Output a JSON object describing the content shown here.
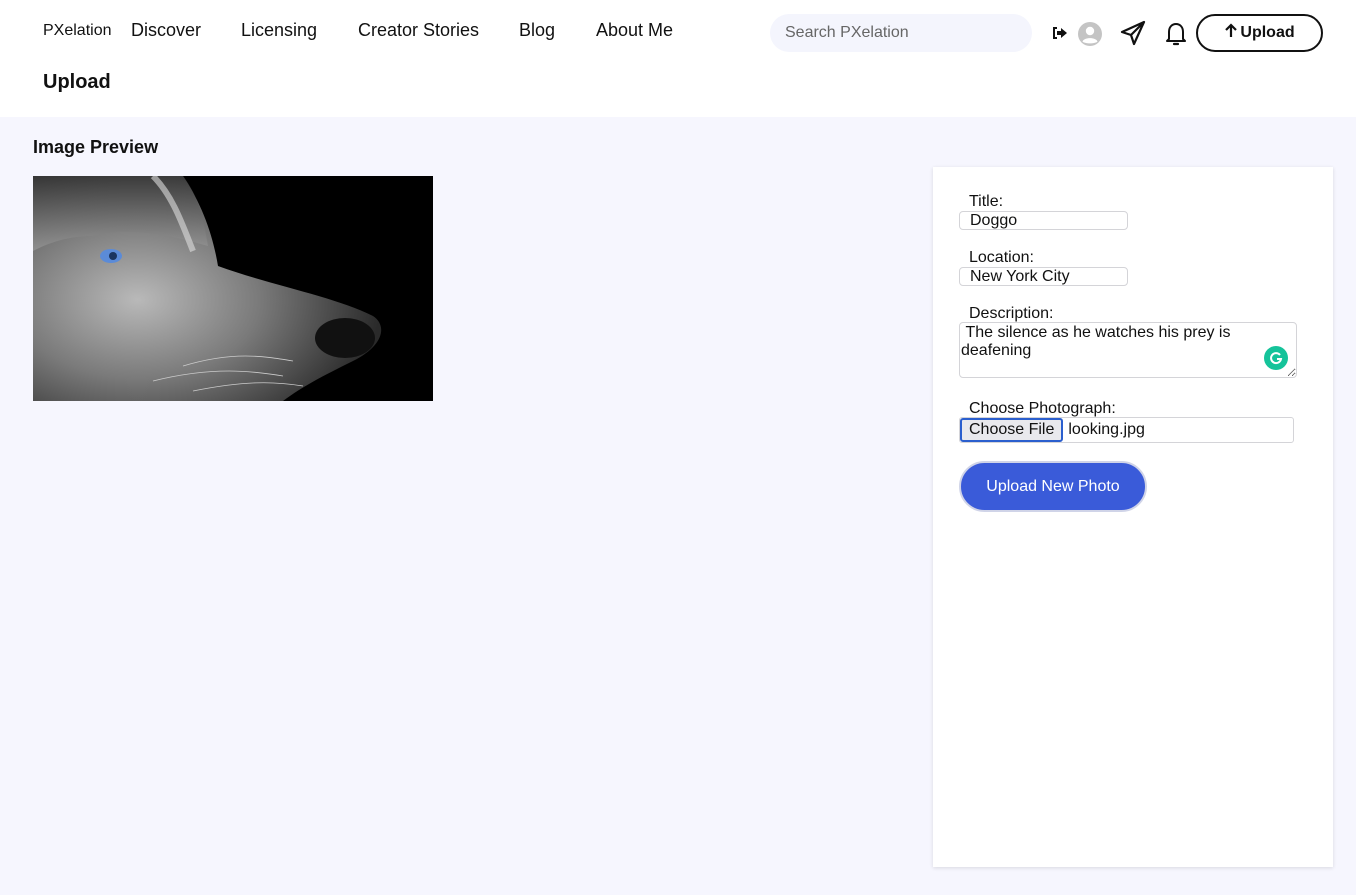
{
  "header": {
    "brand": "PXelation",
    "nav": [
      {
        "label": "Discover"
      },
      {
        "label": "Licensing"
      },
      {
        "label": "Creator Stories"
      },
      {
        "label": "Blog"
      },
      {
        "label": "About Me"
      }
    ],
    "search_placeholder": "Search PXelation",
    "icons": [
      "logout-icon",
      "avatar-icon",
      "send-icon",
      "bell-icon"
    ],
    "upload_label": "Upload",
    "page_title": "Upload"
  },
  "preview": {
    "heading": "Image Preview",
    "image_alt": "Black and white close-up of a husky with a blue eye"
  },
  "form": {
    "title_label": "Title:",
    "title_value": "Doggo",
    "location_label": "Location:",
    "location_value": "New York City",
    "description_label": "Description:",
    "description_value": " The silence as he watches his prey is deafening",
    "photo_label": "Choose Photograph:",
    "choose_file_label": "Choose File",
    "file_name": "looking.jpg",
    "submit_label": "Upload New Photo"
  },
  "colors": {
    "accent": "#3a5bd9",
    "background": "#f6f6fe",
    "grammarly": "#15c39a"
  }
}
